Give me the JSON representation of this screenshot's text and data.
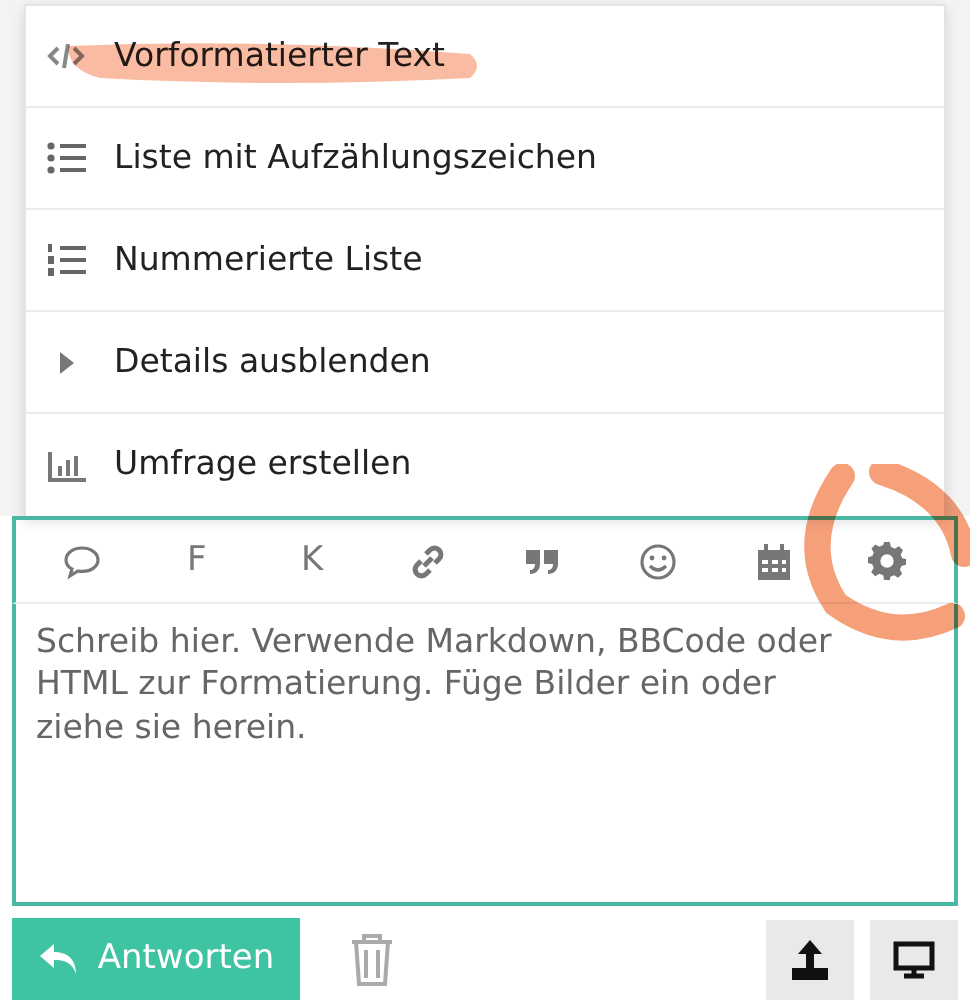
{
  "menu": [
    {
      "label": "Vorformatierter Text"
    },
    {
      "label": "Liste mit Aufzählungszeichen"
    },
    {
      "label": "Nummerierte Liste"
    },
    {
      "label": "Details ausblenden"
    },
    {
      "label": "Umfrage erstellen"
    }
  ],
  "toolbar": [
    {
      "kind": "icon"
    },
    {
      "kind": "text",
      "label": "F"
    },
    {
      "kind": "text",
      "label": "K"
    },
    {
      "kind": "icon"
    },
    {
      "kind": "icon"
    },
    {
      "kind": "icon"
    },
    {
      "kind": "icon"
    },
    {
      "kind": "icon"
    }
  ],
  "editor": {
    "placeholder": "Schreib hier. Verwende Markdown, BBCode oder HTML zur Formatierung. Füge Bilder ein oder ziehe sie herein."
  },
  "reply_button": {
    "label": "Antworten"
  }
}
